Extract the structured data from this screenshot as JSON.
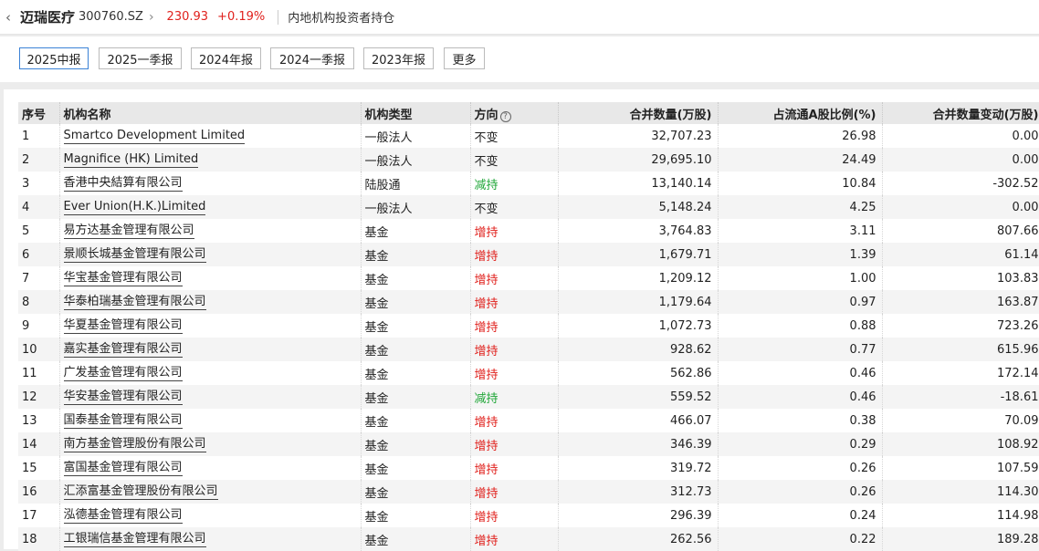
{
  "header": {
    "back_icon": "chevron-left-icon",
    "stock_name": "迈瑞医疗",
    "stock_code": "300760.SZ",
    "next_icon": "chevron-right-icon",
    "price": "230.93",
    "change": "+0.19%",
    "page_title": "内地机构投资者持仓"
  },
  "tabs": [
    {
      "label": "2025中报",
      "active": true
    },
    {
      "label": "2025一季报"
    },
    {
      "label": "2024年报"
    },
    {
      "label": "2024一季报"
    },
    {
      "label": "2023年报"
    },
    {
      "label": "更多"
    }
  ],
  "table": {
    "columns": [
      "序号",
      "机构名称",
      "机构类型",
      "方向",
      "合并数量(万股)",
      "占流通A股比例(%)",
      "合并数量变动(万股)"
    ],
    "direction_help_icon": "question-circle-icon",
    "colors": {
      "up": "#e0211d",
      "down": "#1fa637"
    },
    "rows": [
      {
        "no": "1",
        "name": "Smartco Development Limited",
        "type": "一般法人",
        "dir": "不变",
        "dirClass": "flat",
        "qty": "32,707.23",
        "ratio": "26.98",
        "chg": "0.00"
      },
      {
        "no": "2",
        "name": "Magnifice (HK) Limited",
        "type": "一般法人",
        "dir": "不变",
        "dirClass": "flat",
        "qty": "29,695.10",
        "ratio": "24.49",
        "chg": "0.00"
      },
      {
        "no": "3",
        "name": "香港中央結算有限公司",
        "type": "陆股通",
        "dir": "减持",
        "dirClass": "down",
        "qty": "13,140.14",
        "ratio": "10.84",
        "chg": "-302.52"
      },
      {
        "no": "4",
        "name": "Ever Union(H.K.)Limited",
        "type": "一般法人",
        "dir": "不变",
        "dirClass": "flat",
        "qty": "5,148.24",
        "ratio": "4.25",
        "chg": "0.00"
      },
      {
        "no": "5",
        "name": "易方达基金管理有限公司",
        "type": "基金",
        "dir": "增持",
        "dirClass": "up",
        "qty": "3,764.83",
        "ratio": "3.11",
        "chg": "807.66"
      },
      {
        "no": "6",
        "name": "景顺长城基金管理有限公司",
        "type": "基金",
        "dir": "增持",
        "dirClass": "up",
        "qty": "1,679.71",
        "ratio": "1.39",
        "chg": "61.14"
      },
      {
        "no": "7",
        "name": "华宝基金管理有限公司",
        "type": "基金",
        "dir": "增持",
        "dirClass": "up",
        "qty": "1,209.12",
        "ratio": "1.00",
        "chg": "103.83"
      },
      {
        "no": "8",
        "name": "华泰柏瑞基金管理有限公司",
        "type": "基金",
        "dir": "增持",
        "dirClass": "up",
        "qty": "1,179.64",
        "ratio": "0.97",
        "chg": "163.87"
      },
      {
        "no": "9",
        "name": "华夏基金管理有限公司",
        "type": "基金",
        "dir": "增持",
        "dirClass": "up",
        "qty": "1,072.73",
        "ratio": "0.88",
        "chg": "723.26"
      },
      {
        "no": "10",
        "name": "嘉实基金管理有限公司",
        "type": "基金",
        "dir": "增持",
        "dirClass": "up",
        "qty": "928.62",
        "ratio": "0.77",
        "chg": "615.96"
      },
      {
        "no": "11",
        "name": "广发基金管理有限公司",
        "type": "基金",
        "dir": "增持",
        "dirClass": "up",
        "qty": "562.86",
        "ratio": "0.46",
        "chg": "172.14"
      },
      {
        "no": "12",
        "name": "华安基金管理有限公司",
        "type": "基金",
        "dir": "减持",
        "dirClass": "down",
        "qty": "559.52",
        "ratio": "0.46",
        "chg": "-18.61"
      },
      {
        "no": "13",
        "name": "国泰基金管理有限公司",
        "type": "基金",
        "dir": "增持",
        "dirClass": "up",
        "qty": "466.07",
        "ratio": "0.38",
        "chg": "70.09"
      },
      {
        "no": "14",
        "name": "南方基金管理股份有限公司",
        "type": "基金",
        "dir": "增持",
        "dirClass": "up",
        "qty": "346.39",
        "ratio": "0.29",
        "chg": "108.92"
      },
      {
        "no": "15",
        "name": "富国基金管理有限公司",
        "type": "基金",
        "dir": "增持",
        "dirClass": "up",
        "qty": "319.72",
        "ratio": "0.26",
        "chg": "107.59"
      },
      {
        "no": "16",
        "name": "汇添富基金管理股份有限公司",
        "type": "基金",
        "dir": "增持",
        "dirClass": "up",
        "qty": "312.73",
        "ratio": "0.26",
        "chg": "114.30"
      },
      {
        "no": "17",
        "name": "泓德基金管理有限公司",
        "type": "基金",
        "dir": "增持",
        "dirClass": "up",
        "qty": "296.39",
        "ratio": "0.24",
        "chg": "114.98"
      },
      {
        "no": "18",
        "name": "工银瑞信基金管理有限公司",
        "type": "基金",
        "dir": "增持",
        "dirClass": "up",
        "qty": "262.56",
        "ratio": "0.22",
        "chg": "189.28"
      }
    ]
  }
}
